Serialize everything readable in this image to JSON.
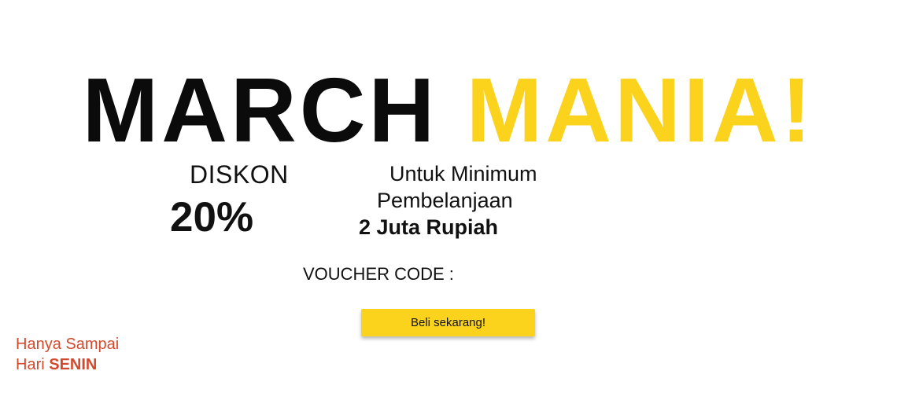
{
  "headline": {
    "word1": "MARCH",
    "word2": "MANIA!"
  },
  "discount": {
    "label": "DISKON",
    "value": "20%"
  },
  "minimum": {
    "line1": "Untuk Minimum",
    "line2": "Pembelanjaan",
    "amount": "2 Juta Rupiah"
  },
  "voucher": {
    "label": "VOUCHER CODE :"
  },
  "cta": {
    "label": "Beli sekarang!"
  },
  "deadline": {
    "line1": "Hanya Sampai",
    "line2_prefix": "Hari ",
    "line2_day": "SENIN"
  },
  "colors": {
    "accent_yellow": "#fcd31c",
    "deadline_red": "#d24a2e",
    "text_dark": "#111111",
    "background": "#ffffff"
  }
}
